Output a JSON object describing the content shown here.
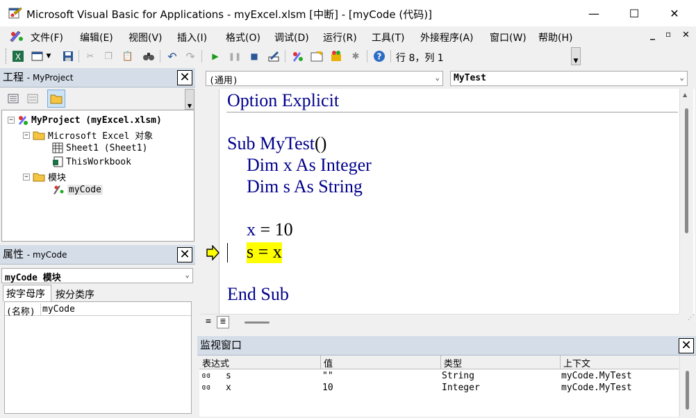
{
  "window": {
    "title": "Microsoft Visual Basic for Applications - myExcel.xlsm [中断] - [myCode (代码)]",
    "minimize": "—",
    "maximize": "☐",
    "close": "✕"
  },
  "menubar": {
    "items": [
      "文件(F)",
      "编辑(E)",
      "视图(V)",
      "插入(I)",
      "格式(O)",
      "调试(D)",
      "运行(R)",
      "工具(T)",
      "外接程序(A)",
      "窗口(W)",
      "帮助(H)"
    ],
    "mdi_min": "_",
    "mdi_restore": "▫",
    "mdi_close": "✕"
  },
  "toolbar": {
    "position": "行 8，列 1"
  },
  "project_panel": {
    "title": "工程",
    "subtitle": "- MyProject",
    "tree": {
      "root": "MyProject (myExcel.xlsm)",
      "excel_objects": "Microsoft Excel 对象",
      "sheet1": "Sheet1 (Sheet1)",
      "thisworkbook": "ThisWorkbook",
      "modules": "模块",
      "mycode": "myCode"
    }
  },
  "properties_panel": {
    "title": "属性",
    "subtitle": "- myCode",
    "object_selector": "myCode 模块",
    "tab_alpha": "按字母序",
    "tab_category": "按分类序",
    "row_name_label": "(名称)",
    "row_name_value": "myCode"
  },
  "code_window": {
    "object_dropdown": "(通用)",
    "proc_dropdown": "MyTest",
    "lines": {
      "l1": "Option Explicit",
      "l2_kw": "Sub",
      "l2_name": "MyTest",
      "l2_paren": "()",
      "l3": "Dim x As Integer",
      "l4": "Dim s As String",
      "l5_var": "x",
      "l5_rest": " = 10",
      "l6": "s = x",
      "l7": "End Sub"
    },
    "highlight_color": "#ffff00",
    "keyword_color": "#00008b"
  },
  "watch_window": {
    "title": "监视窗口",
    "columns": [
      "表达式",
      "值",
      "类型",
      "上下文"
    ],
    "rows": [
      {
        "expr": "s",
        "value": "\"\"",
        "type": "String",
        "context": "myCode.MyTest"
      },
      {
        "expr": "x",
        "value": "10",
        "type": "Integer",
        "context": "myCode.MyTest"
      }
    ]
  }
}
